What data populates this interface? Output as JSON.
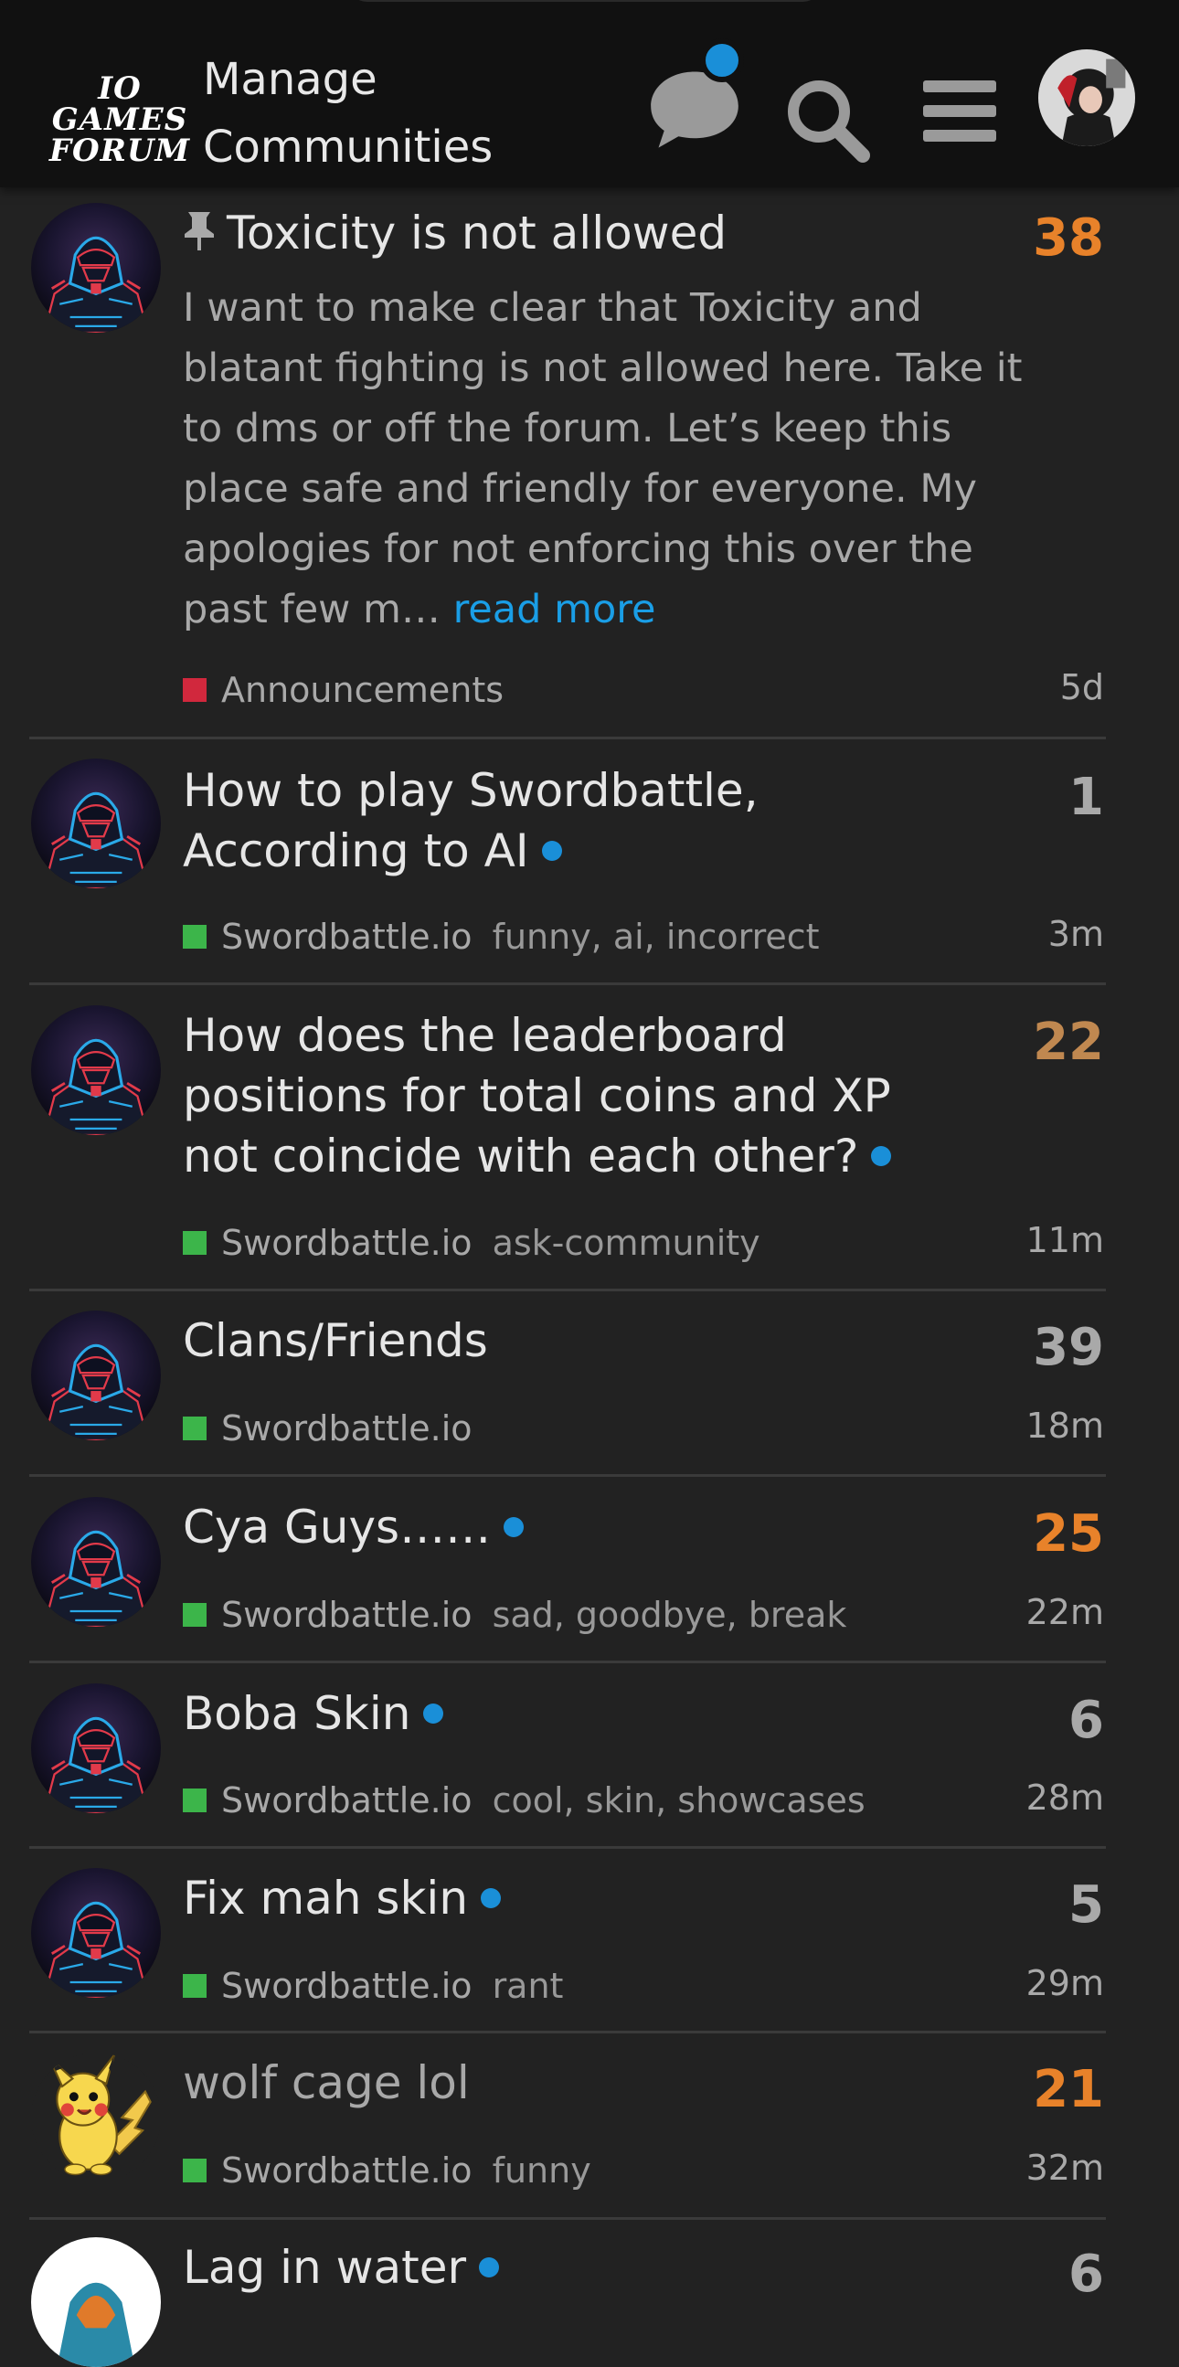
{
  "header": {
    "logo_line1": "IO GAMES",
    "logo_line2": "FORUM",
    "title_line1": "Manage",
    "title_line2": "Communities",
    "icons": [
      "chat-icon",
      "search-icon",
      "menu-icon"
    ],
    "notification_color": "#1a8fd8"
  },
  "colors": {
    "background": "#222222",
    "header": "#111111",
    "announcements": "#d1283d",
    "swordbattle": "#3cb54a",
    "link": "#1a9ee6",
    "hot_count": "#e8822a",
    "warm_count": "#c08850",
    "neutral_count": "#a9a9a9"
  },
  "topics": [
    {
      "title": "Toxicity is not allowed",
      "pinned": true,
      "excerpt": "I want to make clear that Toxicity and blatant fighting is not allowed here. Take it to dms or off the forum. Let’s keep this place safe and friendly for everyone. My apologies for not enforcing this over the past few m…",
      "read_more": "read more",
      "category": "Announcements",
      "tags": "",
      "replies": "38",
      "age": "5d"
    },
    {
      "title_line1": "How to play Swordbattle,",
      "title_line2": "According to AI",
      "category": "Swordbattle.io",
      "tags": "funny, ai, incorrect",
      "replies": "1",
      "age": "3m"
    },
    {
      "title_line1": "How does the leaderboard",
      "title_line2": "positions for total coins and XP",
      "title_line3": "not coincide with each other?",
      "category": "Swordbattle.io",
      "tags": "ask-community",
      "replies": "22",
      "age": "11m"
    },
    {
      "title": "Clans/Friends",
      "category": "Swordbattle.io",
      "tags": "",
      "replies": "39",
      "age": "18m"
    },
    {
      "title": "Cya Guys……",
      "category": "Swordbattle.io",
      "tags": "sad, goodbye, break",
      "replies": "25",
      "age": "22m"
    },
    {
      "title": "Boba Skin",
      "category": "Swordbattle.io",
      "tags": "cool, skin, showcases",
      "replies": "6",
      "age": "28m"
    },
    {
      "title": "Fix mah skin",
      "category": "Swordbattle.io",
      "tags": "rant",
      "replies": "5",
      "age": "29m"
    },
    {
      "title": "wolf cage lol",
      "category": "Swordbattle.io",
      "tags": "funny",
      "replies": "21",
      "age": "32m"
    },
    {
      "title": "Lag in water",
      "replies": "6"
    }
  ]
}
